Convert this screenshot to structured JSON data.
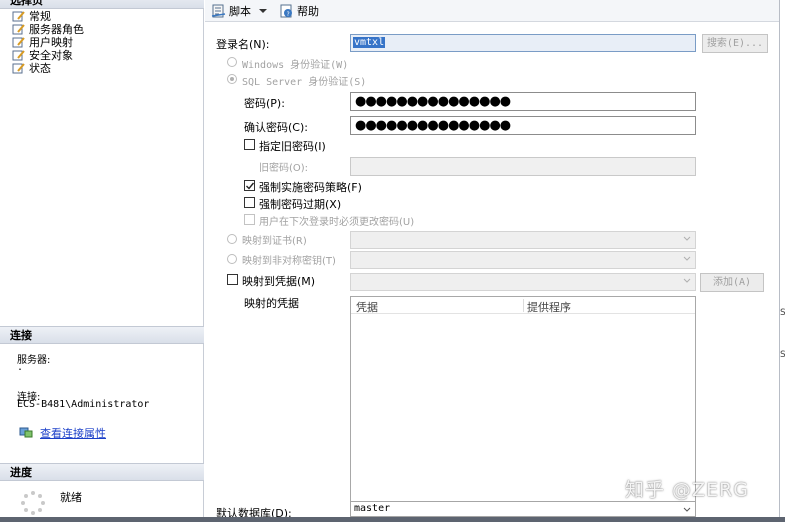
{
  "left_pane": {
    "select_page_header": "选择页",
    "pages": [
      "常规",
      "服务器角色",
      "用户映射",
      "安全对象",
      "状态"
    ],
    "connection_header": "连接",
    "server_label": "服务器:",
    "server_value": ".",
    "connection_label": "连接:",
    "connection_value": "ECS-B481\\Administrator",
    "view_conn_props": "查看连接属性",
    "progress_header": "进度",
    "progress_status": "就绪"
  },
  "toolbar": {
    "script_label": "脚本",
    "help_label": "帮助"
  },
  "form": {
    "login_name_label": "登录名(N):",
    "login_name_value": "vmtxl",
    "search_button": "搜索(E)...",
    "windows_auth": "Windows 身份验证(W)",
    "sql_auth": "SQL Server 身份验证(S)",
    "password_label": "密码(P):",
    "password_value": "●●●●●●●●●●●●●●●",
    "confirm_label": "确认密码(C):",
    "confirm_value": "●●●●●●●●●●●●●●●",
    "specify_old": "指定旧密码(I)",
    "old_password_label": "旧密码(O):",
    "enforce_policy": "强制实施密码策略(F)",
    "enforce_expiration": "强制密码过期(X)",
    "must_change": "用户在下次登录时必须更改密码(U)",
    "map_cert": "映射到证书(R)",
    "map_asym_key": "映射到非对称密钥(T)",
    "map_credential": "映射到凭据(M)",
    "add_button": "添加(A)",
    "mapped_creds_label": "映射的凭据",
    "grid_headers": [
      "凭据",
      "提供程序"
    ],
    "default_db_label": "默认数据库(D):",
    "default_db_value": "master"
  },
  "watermark": "知乎 @ZERG",
  "edge_marks": [
    "S",
    "S"
  ]
}
